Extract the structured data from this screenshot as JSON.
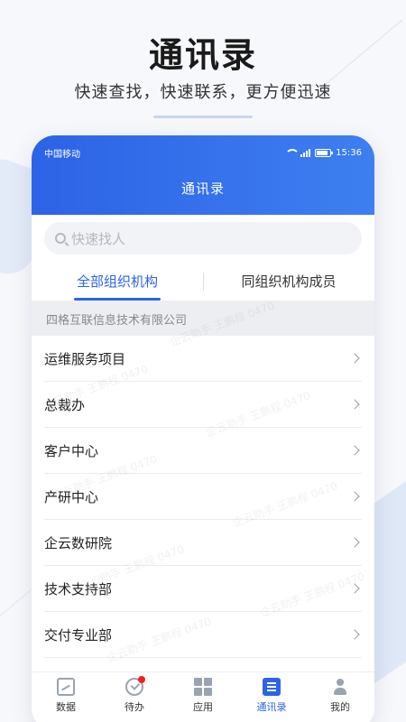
{
  "hero": {
    "title": "通讯录",
    "subtitle": "快速查找，快速联系，更方便迅速"
  },
  "status_bar": {
    "carrier": "中国移动",
    "time": "15:36"
  },
  "header": {
    "title": "通讯录"
  },
  "search": {
    "placeholder": "快速找人"
  },
  "tabs": [
    {
      "label": "全部组织机构",
      "active": true
    },
    {
      "label": "同组织机构成员",
      "active": false
    }
  ],
  "organization": {
    "name": "四格互联信息技术有限公司"
  },
  "departments": [
    {
      "label": "运维服务项目"
    },
    {
      "label": "总裁办"
    },
    {
      "label": "客户中心"
    },
    {
      "label": "产研中心"
    },
    {
      "label": "企云数研院"
    },
    {
      "label": "技术支持部"
    },
    {
      "label": "交付专业部"
    }
  ],
  "watermark": "企云助手 王鹏程 0470",
  "bottom_nav": [
    {
      "label": "数据",
      "icon": "chart-icon"
    },
    {
      "label": "待办",
      "icon": "todo-icon",
      "badge": true
    },
    {
      "label": "应用",
      "icon": "apps-icon"
    },
    {
      "label": "通讯录",
      "icon": "contacts-icon",
      "active": true
    },
    {
      "label": "我的",
      "icon": "profile-icon"
    }
  ],
  "colors": {
    "primary": "#2d63e6",
    "badge": "#e22222"
  }
}
